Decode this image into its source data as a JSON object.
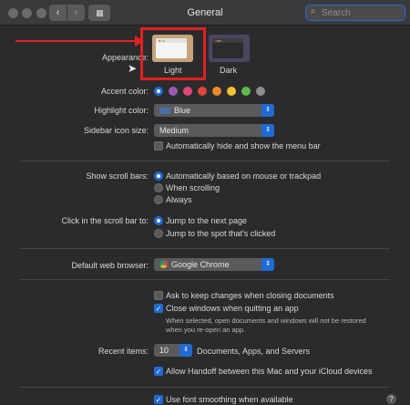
{
  "window": {
    "title": "General",
    "search": {
      "placeholder": "Search",
      "value": ""
    },
    "nav": {
      "back": "‹",
      "forward": "›",
      "grid": "▦"
    }
  },
  "appearance": {
    "label": "Appearance:",
    "options": [
      {
        "label": "Light",
        "selected": true
      },
      {
        "label": "Dark",
        "selected": false
      }
    ]
  },
  "accent": {
    "label": "Accent color:",
    "colors": [
      "#1f6bd3",
      "#9b59b6",
      "#e0457b",
      "#e0453a",
      "#ea8a2a",
      "#f2c230",
      "#5fb84b",
      "#8e8e93"
    ],
    "selected_index": 0
  },
  "highlight": {
    "label": "Highlight color:",
    "value": "Blue",
    "chip_color": "#4b6ea6"
  },
  "sidebar_icon": {
    "label": "Sidebar icon size:",
    "value": "Medium"
  },
  "menu_bar": {
    "label": "Automatically hide and show the menu bar",
    "checked": false
  },
  "scroll_bars": {
    "label": "Show scroll bars:",
    "options": [
      {
        "label": "Automatically based on mouse or trackpad",
        "selected": true
      },
      {
        "label": "When scrolling",
        "selected": false
      },
      {
        "label": "Always",
        "selected": false
      }
    ]
  },
  "click_scroll": {
    "label": "Click in the scroll bar to:",
    "options": [
      {
        "label": "Jump to the next page",
        "selected": true
      },
      {
        "label": "Jump to the spot that's clicked",
        "selected": false
      }
    ]
  },
  "browser": {
    "label": "Default web browser:",
    "value": "Google Chrome"
  },
  "documents": {
    "ask_keep": {
      "label": "Ask to keep changes when closing documents",
      "checked": false
    },
    "close_windows": {
      "label": "Close windows when quitting an app",
      "checked": true
    },
    "note_line1": "When selected, open documents and windows will not be restored",
    "note_line2": "when you re-open an app."
  },
  "recent": {
    "label": "Recent items:",
    "value": "10",
    "suffix": "Documents, Apps, and Servers"
  },
  "handoff": {
    "label": "Allow Handoff between this Mac and your iCloud devices",
    "checked": true
  },
  "font_smoothing": {
    "label": "Use font smoothing when available",
    "checked": true
  },
  "help": "?",
  "annotation_color": "#e0211f"
}
